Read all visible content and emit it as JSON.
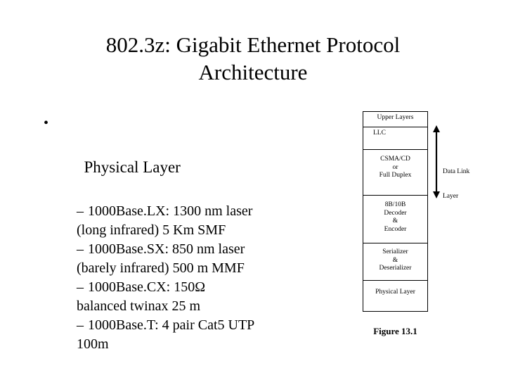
{
  "slide": {
    "title_lines": [
      "802.3z: Gigabit Ethernet Protocol",
      "Architecture"
    ],
    "background_color": "#ffffff",
    "text_color": "#000000"
  },
  "body": {
    "bullet_glyph": "•",
    "dash_glyph": "–",
    "level1": {
      "label": "Physical Layer"
    },
    "level2": [
      {
        "line1": "1000Base.LX: 1300 nm laser",
        "line2": "(long infrared) 5 Km SMF"
      },
      {
        "line1": "1000Base.SX: 850 nm laser",
        "line2": "(barely infrared) 500 m MMF"
      },
      {
        "line1": "1000Base.CX: 150Ω",
        "line2": "balanced twinax 25 m"
      },
      {
        "line1": "1000Base.T: 4 pair Cat5 UTP",
        "line2": "100m"
      }
    ]
  },
  "diagram": {
    "boxes": [
      {
        "line1": "Upper Layers",
        "line2": "",
        "line3": ""
      },
      {
        "line1": "LLC",
        "line2": "",
        "line3": ""
      },
      {
        "line1": "CSMA/CD",
        "line2": "or",
        "line3": "Full Duplex"
      },
      {
        "line1": "8B/10B",
        "line2": "Decoder",
        "line3": "&",
        "line4": "Encoder"
      },
      {
        "line1": "Serializer",
        "line2": "&",
        "line3": "Deserializer"
      },
      {
        "line1": "Physical Layer",
        "line2": "",
        "line3": ""
      }
    ],
    "annotation": {
      "line1": "Data Link",
      "line2": "Layer"
    },
    "caption": "Figure 13.1",
    "line_color": "#000000"
  }
}
